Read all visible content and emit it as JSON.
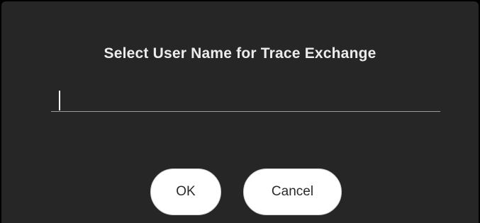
{
  "dialog": {
    "title": "Select User Name for Trace Exchange",
    "username_field": {
      "value": "",
      "placeholder": ""
    },
    "buttons": {
      "ok_label": "OK",
      "cancel_label": "Cancel"
    }
  },
  "colors": {
    "background": "#262626",
    "title_text": "#ececec",
    "button_bg": "#ffffff",
    "button_text": "#2a2a2a",
    "field_underline": "#9a9a9a"
  }
}
